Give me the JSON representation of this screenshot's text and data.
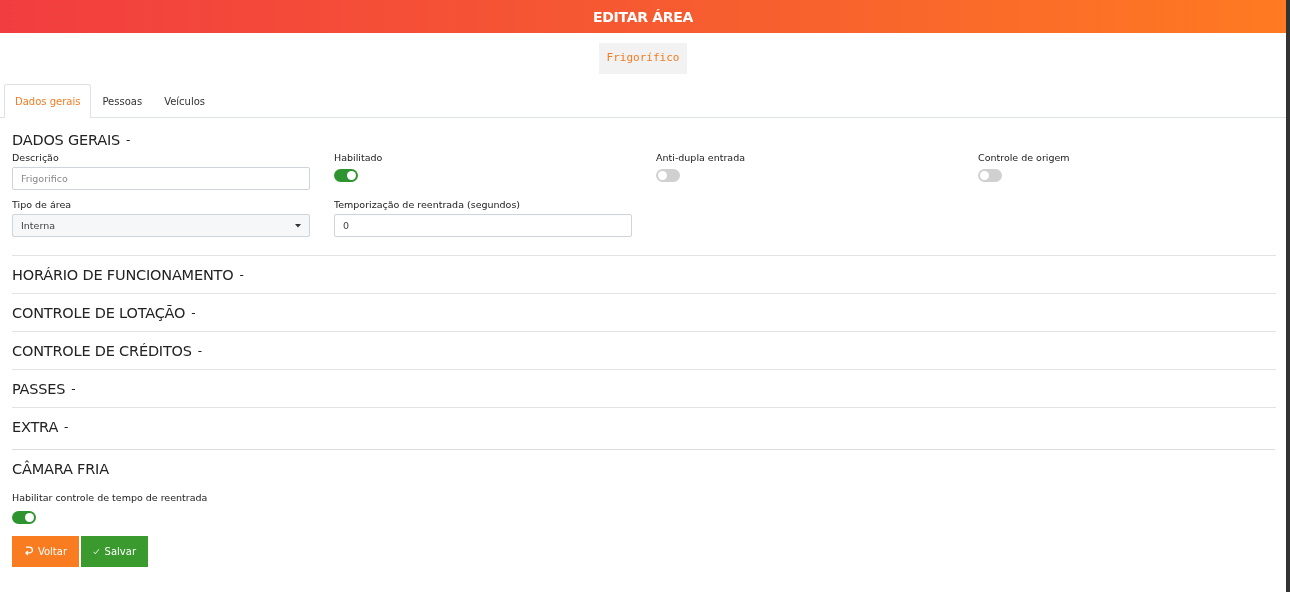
{
  "header": {
    "title": "EDITAR ÁREA"
  },
  "area_badge": "Frigorífico",
  "tabs": [
    {
      "label": "Dados gerais",
      "selected": true
    },
    {
      "label": "Pessoas",
      "selected": false
    },
    {
      "label": "Veículos",
      "selected": false
    }
  ],
  "general": {
    "title": "DADOS GERAIS",
    "toggle": "-",
    "fields": [
      {
        "kind": "text",
        "label": "Descrição",
        "placeholder": "Frigorifico"
      },
      {
        "kind": "switch",
        "label": "Habilitado",
        "on": true
      },
      {
        "kind": "switch",
        "label": "Anti-dupla entrada",
        "on": false
      },
      {
        "kind": "switch",
        "label": "Controle de origem",
        "on": false
      },
      {
        "kind": "select",
        "label": "Tipo de área",
        "value": "Interna"
      },
      {
        "kind": "text",
        "label": "Temporização de reentrada (segundos)",
        "value": "0"
      }
    ]
  },
  "sections": [
    {
      "title": "HORÁRIO DE FUNCIONAMENTO",
      "toggle": "-"
    },
    {
      "title": "CONTROLE DE LOTAÇÃO",
      "toggle": "-"
    },
    {
      "title": "CONTROLE DE CRÉDITOS",
      "toggle": "-"
    },
    {
      "title": "PASSES",
      "toggle": "-"
    },
    {
      "title": "EXTRA",
      "toggle": "-"
    }
  ],
  "cold_room": {
    "title": "CÂMARA FRIA",
    "label": "Habilitar controle de tempo de reentrada",
    "on": true
  },
  "buttons": [
    {
      "kind": "back",
      "label": "Voltar"
    },
    {
      "kind": "save",
      "label": "Salvar"
    }
  ]
}
